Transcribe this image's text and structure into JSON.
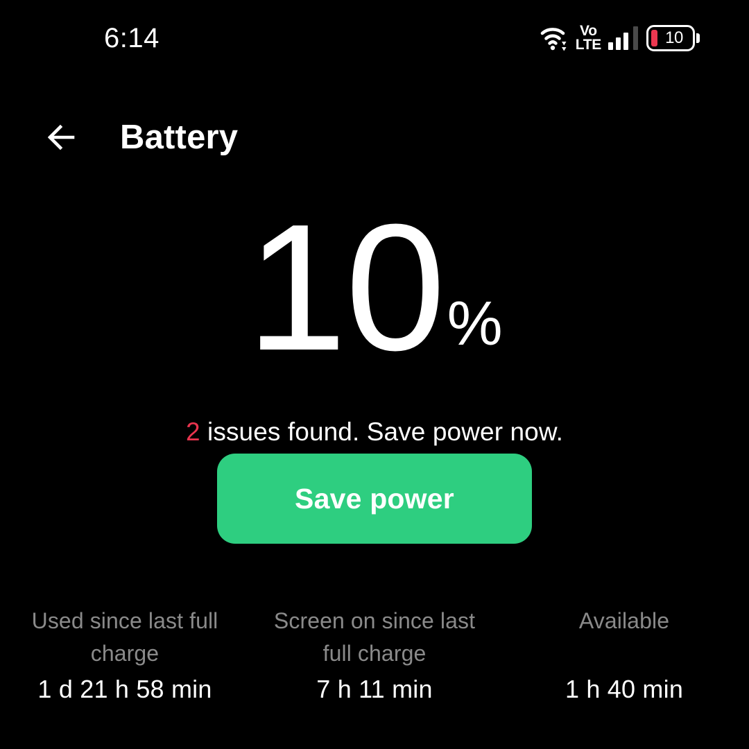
{
  "status_bar": {
    "time": "6:14",
    "wifi_icon": "wifi-icon",
    "volte_top": "Vo",
    "volte_bottom": "LTE",
    "signal_icon": "signal-bars-icon",
    "battery_level": "10",
    "battery_accent_color": "#ec3750"
  },
  "header": {
    "back_icon": "back-arrow-icon",
    "title": "Battery"
  },
  "battery": {
    "percent_value": "10",
    "percent_sign": "%"
  },
  "issues": {
    "count": "2",
    "message": " issues found. Save power now.",
    "count_color": "#e8344e"
  },
  "actions": {
    "save_power_label": "Save power",
    "save_power_color": "#2ece80"
  },
  "stats": [
    {
      "label": "Used since last full charge",
      "value": "1 d 21 h 58 min"
    },
    {
      "label": "Screen on since last full charge",
      "value": "7 h 11 min"
    },
    {
      "label": "Available",
      "value": "1 h 40 min"
    }
  ]
}
